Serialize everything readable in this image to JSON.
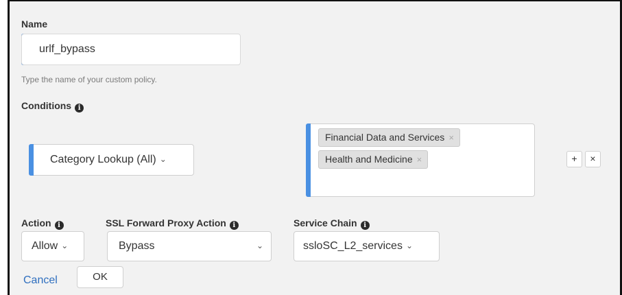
{
  "name": {
    "label": "Name",
    "value": "urlf_bypass",
    "help_text": "Type the name of your custom policy."
  },
  "conditions": {
    "label": "Conditions",
    "info_icon": "i",
    "type_select": "Category Lookup (All)",
    "chevron": "⌄",
    "tags": [
      {
        "label": "Financial Data and Services",
        "remove": "×"
      },
      {
        "label": "Health and Medicine",
        "remove": "×"
      }
    ],
    "add_button": "+",
    "remove_button": "×"
  },
  "action": {
    "label": "Action",
    "value": "Allow"
  },
  "ssl_forward_proxy_action": {
    "label": "SSL Forward Proxy Action",
    "value": "Bypass"
  },
  "service_chain": {
    "label": "Service Chain",
    "value": "ssloSC_L2_services"
  },
  "footer": {
    "cancel": "Cancel",
    "ok": "OK"
  },
  "colors": {
    "accent": "#4a90e2",
    "link": "#2f6fbf",
    "background": "#f2f2f2",
    "tag_bg": "#e0e0e0"
  }
}
